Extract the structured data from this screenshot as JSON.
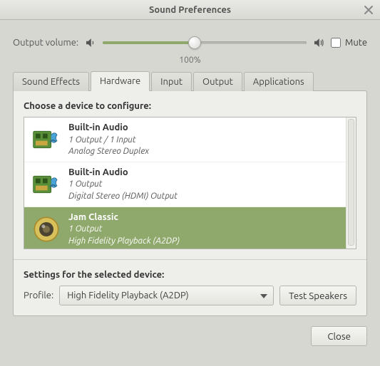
{
  "window": {
    "title": "Sound Preferences"
  },
  "volume": {
    "label": "Output volume:",
    "percent_label": "100%",
    "mute_label": "Mute",
    "muted": false
  },
  "tabs": [
    {
      "label": "Sound Effects",
      "active": false
    },
    {
      "label": "Hardware",
      "active": true
    },
    {
      "label": "Input",
      "active": false
    },
    {
      "label": "Output",
      "active": false
    },
    {
      "label": "Applications",
      "active": false
    }
  ],
  "devices": {
    "heading": "Choose a device to configure:",
    "items": [
      {
        "name": "Built-in Audio",
        "io": "1 Output / 1 Input",
        "profile": "Analog Stereo Duplex",
        "icon": "soundcard",
        "selected": false
      },
      {
        "name": "Built-in Audio",
        "io": "1 Output",
        "profile": "Digital Stereo (HDMI) Output",
        "icon": "soundcard",
        "selected": false
      },
      {
        "name": "Jam Classic",
        "io": "1 Output",
        "profile": "High Fidelity Playback (A2DP)",
        "icon": "speaker",
        "selected": true
      }
    ]
  },
  "settings": {
    "heading": "Settings for the selected device:",
    "profile_label": "Profile:",
    "profile_value": "High Fidelity Playback (A2DP)",
    "test_label": "Test Speakers"
  },
  "footer": {
    "close_label": "Close"
  }
}
